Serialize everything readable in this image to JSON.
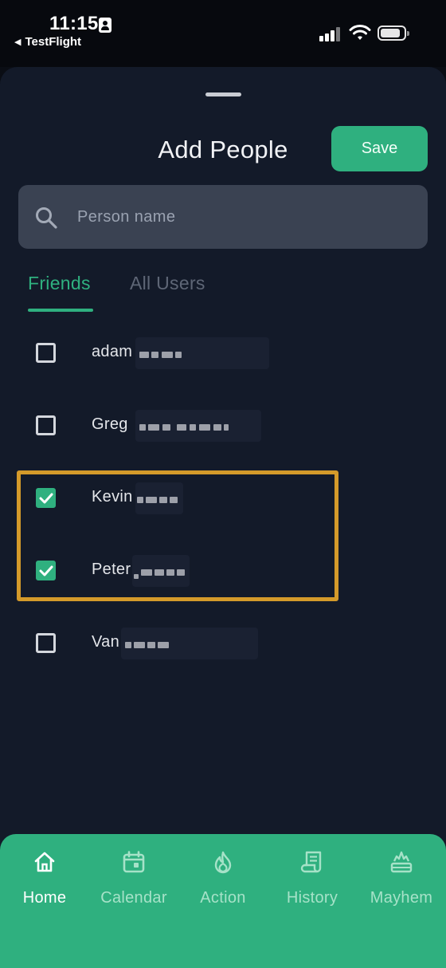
{
  "status_bar": {
    "time": "11:15",
    "back_app": "TestFlight"
  },
  "header": {
    "title": "Add People",
    "save_label": "Save"
  },
  "search": {
    "placeholder": "Person name"
  },
  "tabs": [
    {
      "label": "Friends",
      "active": true
    },
    {
      "label": "All Users",
      "active": false
    }
  ],
  "people": [
    {
      "first_name": "adam",
      "checked": false
    },
    {
      "first_name": "Greg",
      "checked": false
    },
    {
      "first_name": "Kevin",
      "checked": true
    },
    {
      "first_name": "Peter",
      "checked": true
    },
    {
      "first_name": "Van",
      "checked": false
    }
  ],
  "bottom_nav": [
    {
      "label": "Home",
      "icon": "home-icon",
      "active": true
    },
    {
      "label": "Calendar",
      "icon": "calendar-icon",
      "active": false
    },
    {
      "label": "Action",
      "icon": "flame-icon",
      "active": false
    },
    {
      "label": "History",
      "icon": "scroll-icon",
      "active": false
    },
    {
      "label": "Mayhem",
      "icon": "explosion-icon",
      "active": false
    }
  ],
  "colors": {
    "accent": "#2fb07f",
    "background": "#131a29",
    "highlight": "#d49a2a"
  }
}
